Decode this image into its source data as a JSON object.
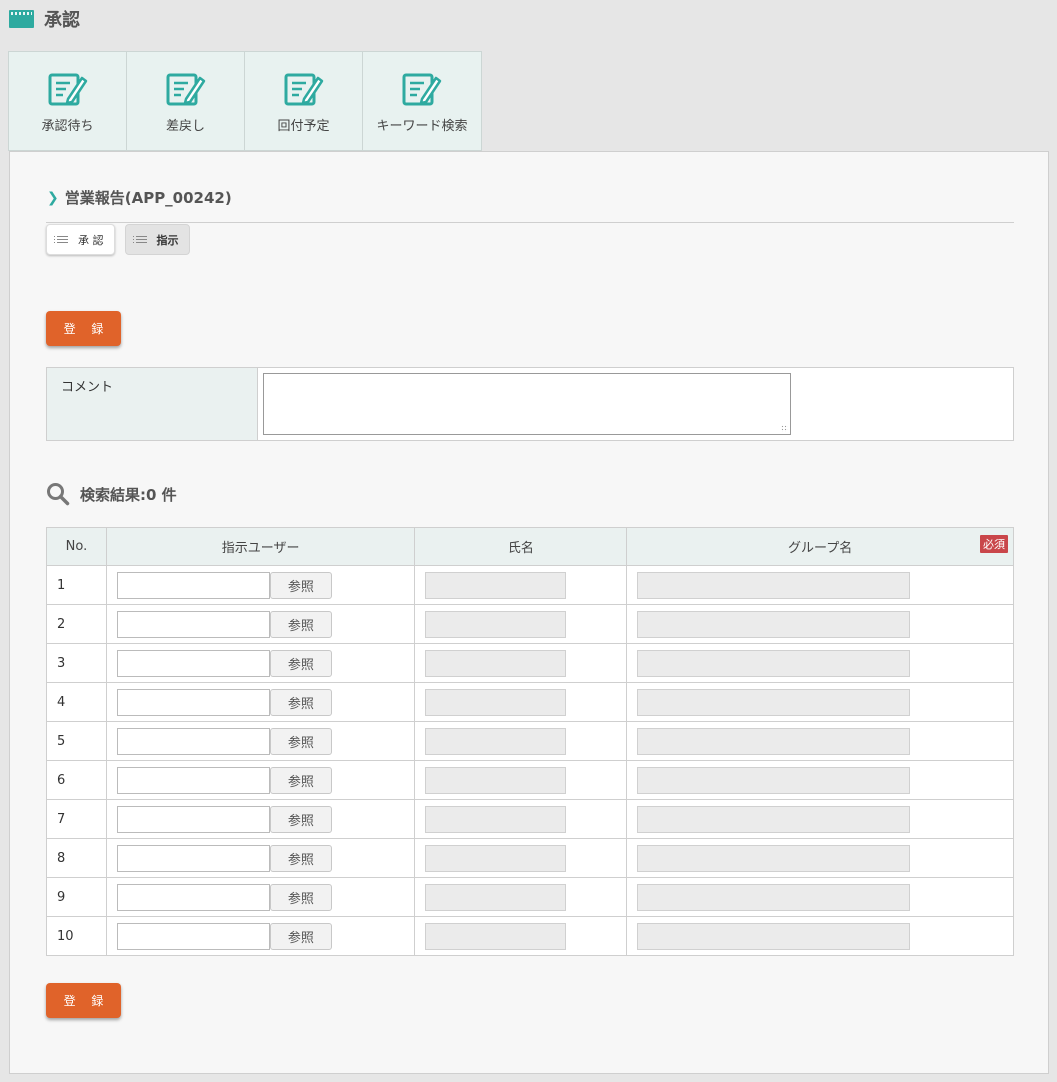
{
  "page": {
    "title": "承認"
  },
  "tabs": [
    {
      "label": "承認待ち"
    },
    {
      "label": "差戻し"
    },
    {
      "label": "回付予定"
    },
    {
      "label": "キーワード検索"
    }
  ],
  "section": {
    "title": "営業報告(APP_00242)"
  },
  "subtabs": [
    {
      "label": "承 認",
      "active": true
    },
    {
      "label": "指示",
      "active": false
    }
  ],
  "actions": {
    "register_label": "登 録"
  },
  "comment": {
    "label": "コメント",
    "value": ""
  },
  "search": {
    "result_label": "検索結果:0 件"
  },
  "table": {
    "headers": {
      "no": "No.",
      "user": "指示ユーザー",
      "name": "氏名",
      "group": "グループ名"
    },
    "required_badge": "必須",
    "ref_label": "参照",
    "rows": [
      {
        "no": "1",
        "user": "",
        "name": "",
        "group": ""
      },
      {
        "no": "2",
        "user": "",
        "name": "",
        "group": ""
      },
      {
        "no": "3",
        "user": "",
        "name": "",
        "group": ""
      },
      {
        "no": "4",
        "user": "",
        "name": "",
        "group": ""
      },
      {
        "no": "5",
        "user": "",
        "name": "",
        "group": ""
      },
      {
        "no": "6",
        "user": "",
        "name": "",
        "group": ""
      },
      {
        "no": "7",
        "user": "",
        "name": "",
        "group": ""
      },
      {
        "no": "8",
        "user": "",
        "name": "",
        "group": ""
      },
      {
        "no": "9",
        "user": "",
        "name": "",
        "group": ""
      },
      {
        "no": "10",
        "user": "",
        "name": "",
        "group": ""
      }
    ]
  },
  "colors": {
    "accent": "#2eaaa0",
    "button": "#e0632a",
    "required": "#c9464a"
  },
  "icons": {
    "title": "window-icon",
    "tab": "edit-note-icon",
    "search": "search-icon",
    "list": "list-icon"
  }
}
